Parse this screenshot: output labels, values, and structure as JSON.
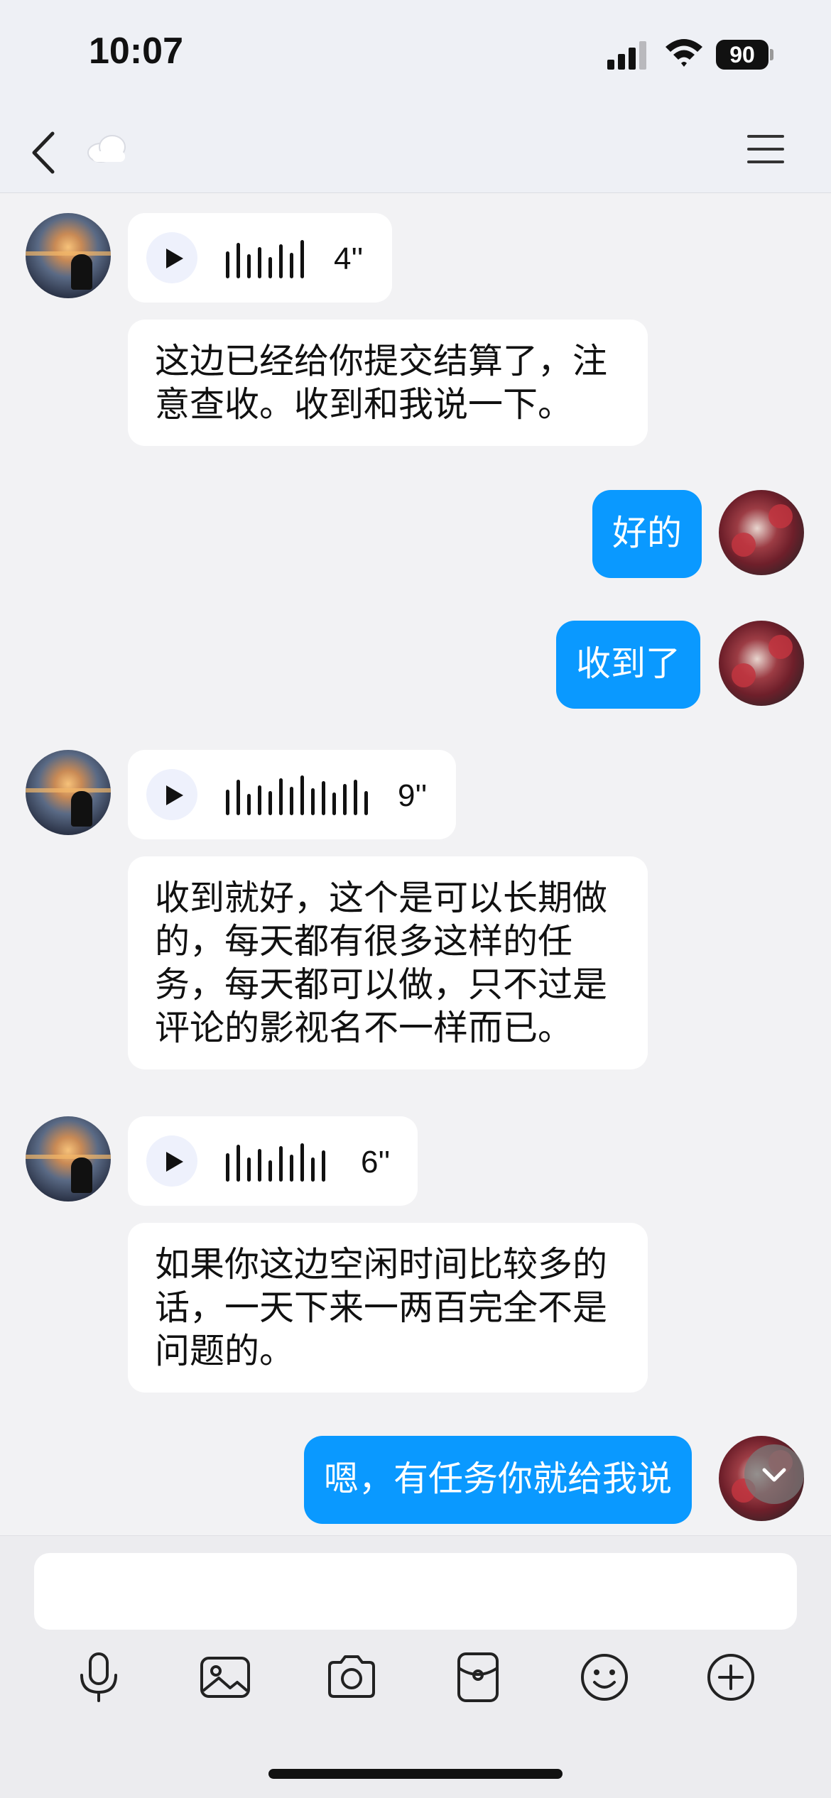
{
  "status_bar": {
    "time": "10:07",
    "battery": "90"
  },
  "header": {
    "back_icon": "chevron-left-icon",
    "title_icon": "cloud-icon",
    "menu_icon": "hamburger-menu-icon"
  },
  "messages": [
    {
      "from": "other",
      "type": "voice",
      "duration": "4''"
    },
    {
      "from": "other",
      "type": "text",
      "lines": [
        "这边已经给你提交结算了，注",
        "意查收。收到和我说一下。"
      ]
    },
    {
      "from": "me",
      "type": "text",
      "text": "好的"
    },
    {
      "from": "me",
      "type": "text",
      "text": "收到了"
    },
    {
      "from": "other",
      "type": "voice",
      "duration": "9''"
    },
    {
      "from": "other",
      "type": "text",
      "lines": [
        "收到就好，这个是可以长期做",
        "的，每天都有很多这样的任",
        "务，每天都可以做，只不过是",
        "评论的影视名不一样而已。"
      ]
    },
    {
      "from": "other",
      "type": "voice",
      "duration": "6''"
    },
    {
      "from": "other",
      "type": "text",
      "lines": [
        "如果你这边空闲时间比较多的",
        "话，一天下来一两百完全不是",
        "问题的。"
      ]
    },
    {
      "from": "me",
      "type": "text",
      "text": "嗯，有任务你就给我说"
    }
  ],
  "input": {
    "placeholder": ""
  },
  "toolbar": [
    "microphone-icon",
    "image-icon",
    "camera-icon",
    "red-packet-icon",
    "emoji-icon",
    "plus-icon"
  ],
  "colors": {
    "accent": "#0a99ff",
    "background": "#f2f2f4"
  }
}
